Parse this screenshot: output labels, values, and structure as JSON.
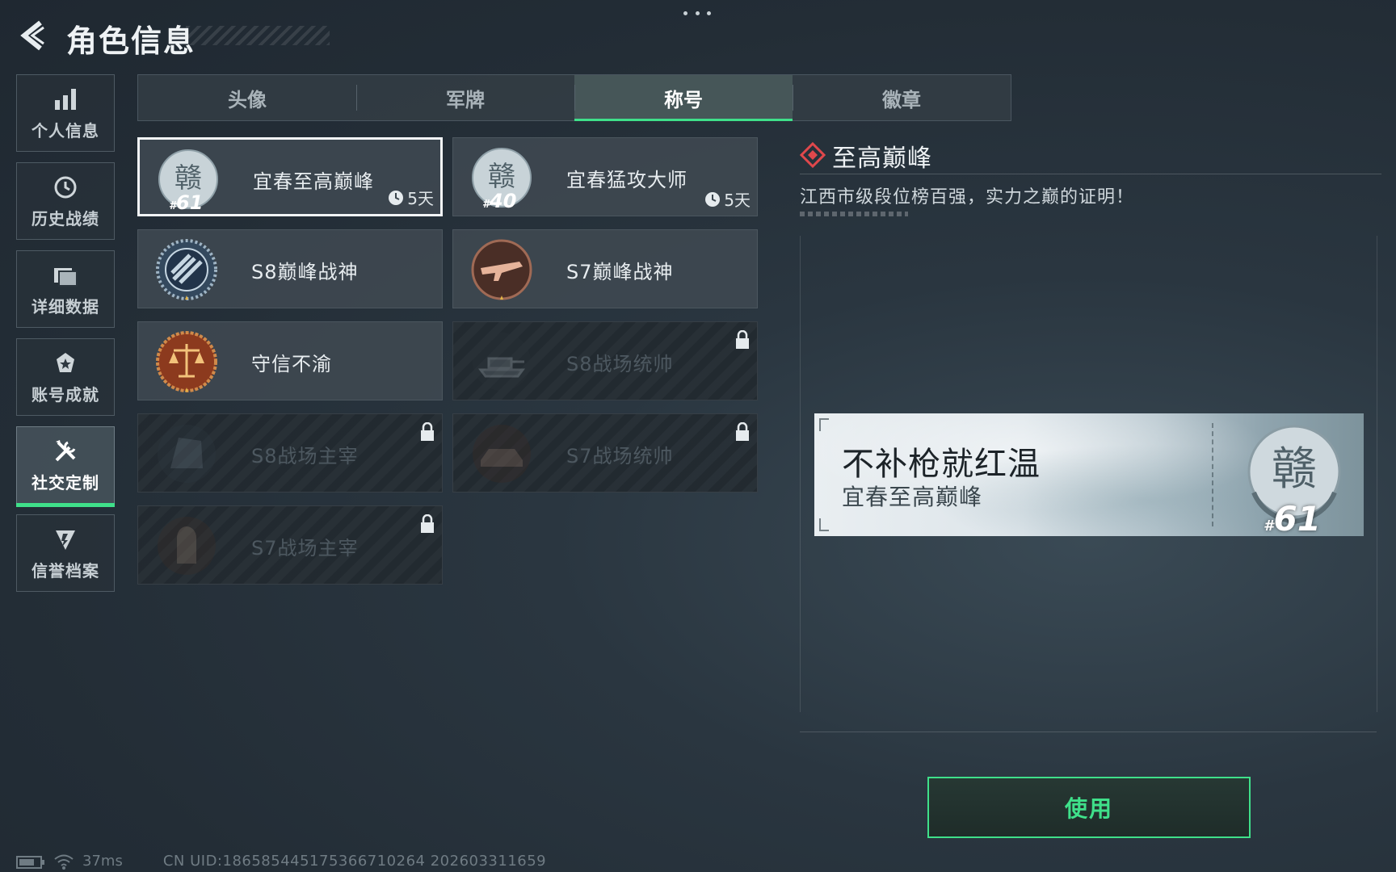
{
  "header": {
    "title": "角色信息"
  },
  "sidebar": {
    "items": [
      {
        "label": "个人信息",
        "icon": "bar-chart-icon",
        "active": false
      },
      {
        "label": "历史战绩",
        "icon": "history-icon",
        "active": false
      },
      {
        "label": "详细数据",
        "icon": "folder-icon",
        "active": false
      },
      {
        "label": "账号成就",
        "icon": "achievement-icon",
        "active": false
      },
      {
        "label": "社交定制",
        "icon": "tools-icon",
        "active": true
      },
      {
        "label": "信誉档案",
        "icon": "credit-shield-icon",
        "active": false
      }
    ]
  },
  "tabs": [
    {
      "label": "头像",
      "active": false
    },
    {
      "label": "军牌",
      "active": false
    },
    {
      "label": "称号",
      "active": true
    },
    {
      "label": "徽章",
      "active": false
    }
  ],
  "titles": [
    {
      "name": "宜春至高巅峰",
      "rank": "61",
      "timer": "5天",
      "selected": true,
      "locked": false,
      "icon": "city-emblem-icon"
    },
    {
      "name": "宜春猛攻大师",
      "rank": "40",
      "timer": "5天",
      "selected": false,
      "locked": false,
      "icon": "city-emblem-icon"
    },
    {
      "name": "S8巅峰战神",
      "selected": false,
      "locked": false,
      "icon": "s8-emblem-icon"
    },
    {
      "name": "S7巅峰战神",
      "selected": false,
      "locked": false,
      "icon": "s7-rifle-emblem-icon"
    },
    {
      "name": "守信不渝",
      "selected": false,
      "locked": false,
      "icon": "scales-emblem-icon"
    },
    {
      "name": "S8战场统帅",
      "selected": false,
      "locked": true,
      "icon": "tank-emblem-icon"
    },
    {
      "name": "S8战场主宰",
      "selected": false,
      "locked": true,
      "icon": "building-emblem-icon"
    },
    {
      "name": "S7战场统帅",
      "selected": false,
      "locked": true,
      "icon": "vehicle-emblem-icon"
    },
    {
      "name": "S7战场主宰",
      "selected": false,
      "locked": true,
      "icon": "soldier-emblem-icon"
    }
  ],
  "detail": {
    "title": "至高巅峰",
    "description": "江西市级段位榜百强，实力之巅的证明！"
  },
  "preview": {
    "player_name": "不补枪就红温",
    "title": "宜春至高巅峰",
    "rank": "61"
  },
  "actions": {
    "use_label": "使用"
  },
  "status_bar": {
    "ping": "37ms",
    "uid": "CN UID:1865854451753667102​64 202603311659"
  },
  "colors": {
    "accent": "#3fe08a",
    "diamond": "#e0484c"
  }
}
